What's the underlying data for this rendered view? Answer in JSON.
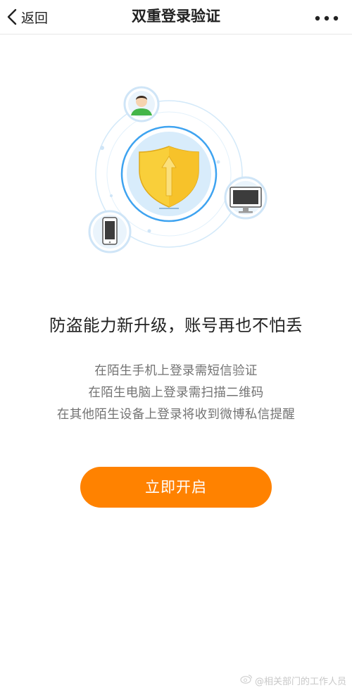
{
  "header": {
    "back_label": "返回",
    "title": "双重登录验证",
    "back_icon": "chevron-left-icon",
    "more_icon": "more-horizontal-icon"
  },
  "main": {
    "headline": "防盗能力新升级，账号再也不怕丢",
    "descriptions": [
      "在陌生手机上登录需短信验证",
      "在陌生电脑上登录需扫描二维码",
      "在其他陌生设备上登录将收到微博私信提醒"
    ],
    "enable_button_label": "立即开启"
  },
  "illustration": {
    "center_icon": "shield-icon",
    "satellite_icons": [
      "user-avatar-icon",
      "monitor-icon",
      "smartphone-icon"
    ]
  },
  "watermark": {
    "text": "@相关部门的工作人员",
    "icon": "weibo-logo-icon"
  },
  "colors": {
    "accent": "#ff8200",
    "shield_gold": "#f9cf3a",
    "ring_blue": "#3ea3f0",
    "circle_fill": "#d8ecfb",
    "text_primary": "#222222",
    "text_secondary": "#737373"
  }
}
